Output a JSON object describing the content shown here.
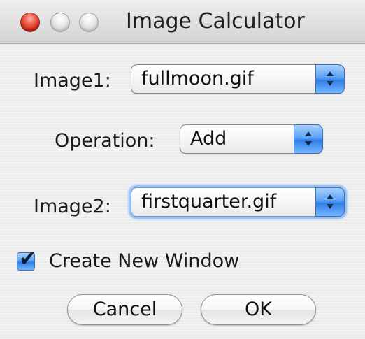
{
  "window": {
    "title": "Image Calculator"
  },
  "fields": {
    "image1_label": "Image1:",
    "image1_value": "fullmoon.gif",
    "operation_label": "Operation:",
    "operation_value": "Add",
    "image2_label": "Image2:",
    "image2_value": "firstquarter.gif"
  },
  "options": {
    "create_new_window_label": "Create New Window",
    "create_new_window_checked": true
  },
  "buttons": {
    "cancel_label": "Cancel",
    "ok_label": "OK"
  },
  "colors": {
    "accent_blue": "#5aa2f5",
    "close_red": "#f0604e"
  }
}
